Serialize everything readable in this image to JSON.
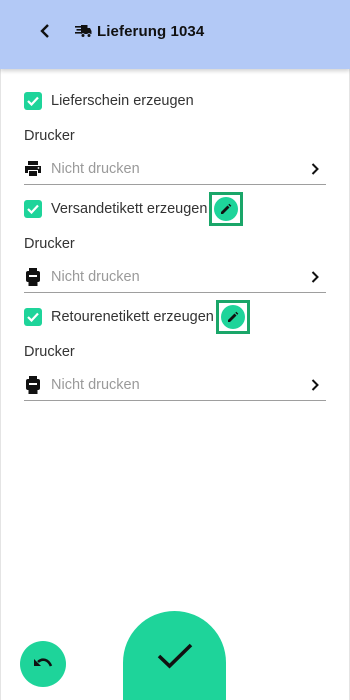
{
  "header": {
    "title": "Lieferung 1034",
    "back_icon": "chevron-left-icon",
    "title_icon": "delivery-icon",
    "background": "#b3c9f6"
  },
  "options": [
    {
      "label": "Lieferschein erzeugen",
      "checked": true,
      "editable": false,
      "printer_label": "Drucker",
      "printer_value": "Nicht drucken",
      "printer_icon": "printer-icon"
    },
    {
      "label": "Versandetikett erzeugen",
      "checked": true,
      "editable": true,
      "printer_label": "Drucker",
      "printer_value": "Nicht drucken",
      "printer_icon": "label-printer-icon"
    },
    {
      "label": "Retourenetikett erzeugen",
      "checked": true,
      "editable": true,
      "printer_label": "Drucker",
      "printer_value": "Nicht drucken",
      "printer_icon": "label-printer-icon"
    }
  ],
  "actions": {
    "undo_icon": "undo-icon",
    "confirm_icon": "checkmark-icon"
  },
  "colors": {
    "accent": "#1ed49a",
    "highlight_border": "#1aa669",
    "header": "#b3c9f6"
  }
}
